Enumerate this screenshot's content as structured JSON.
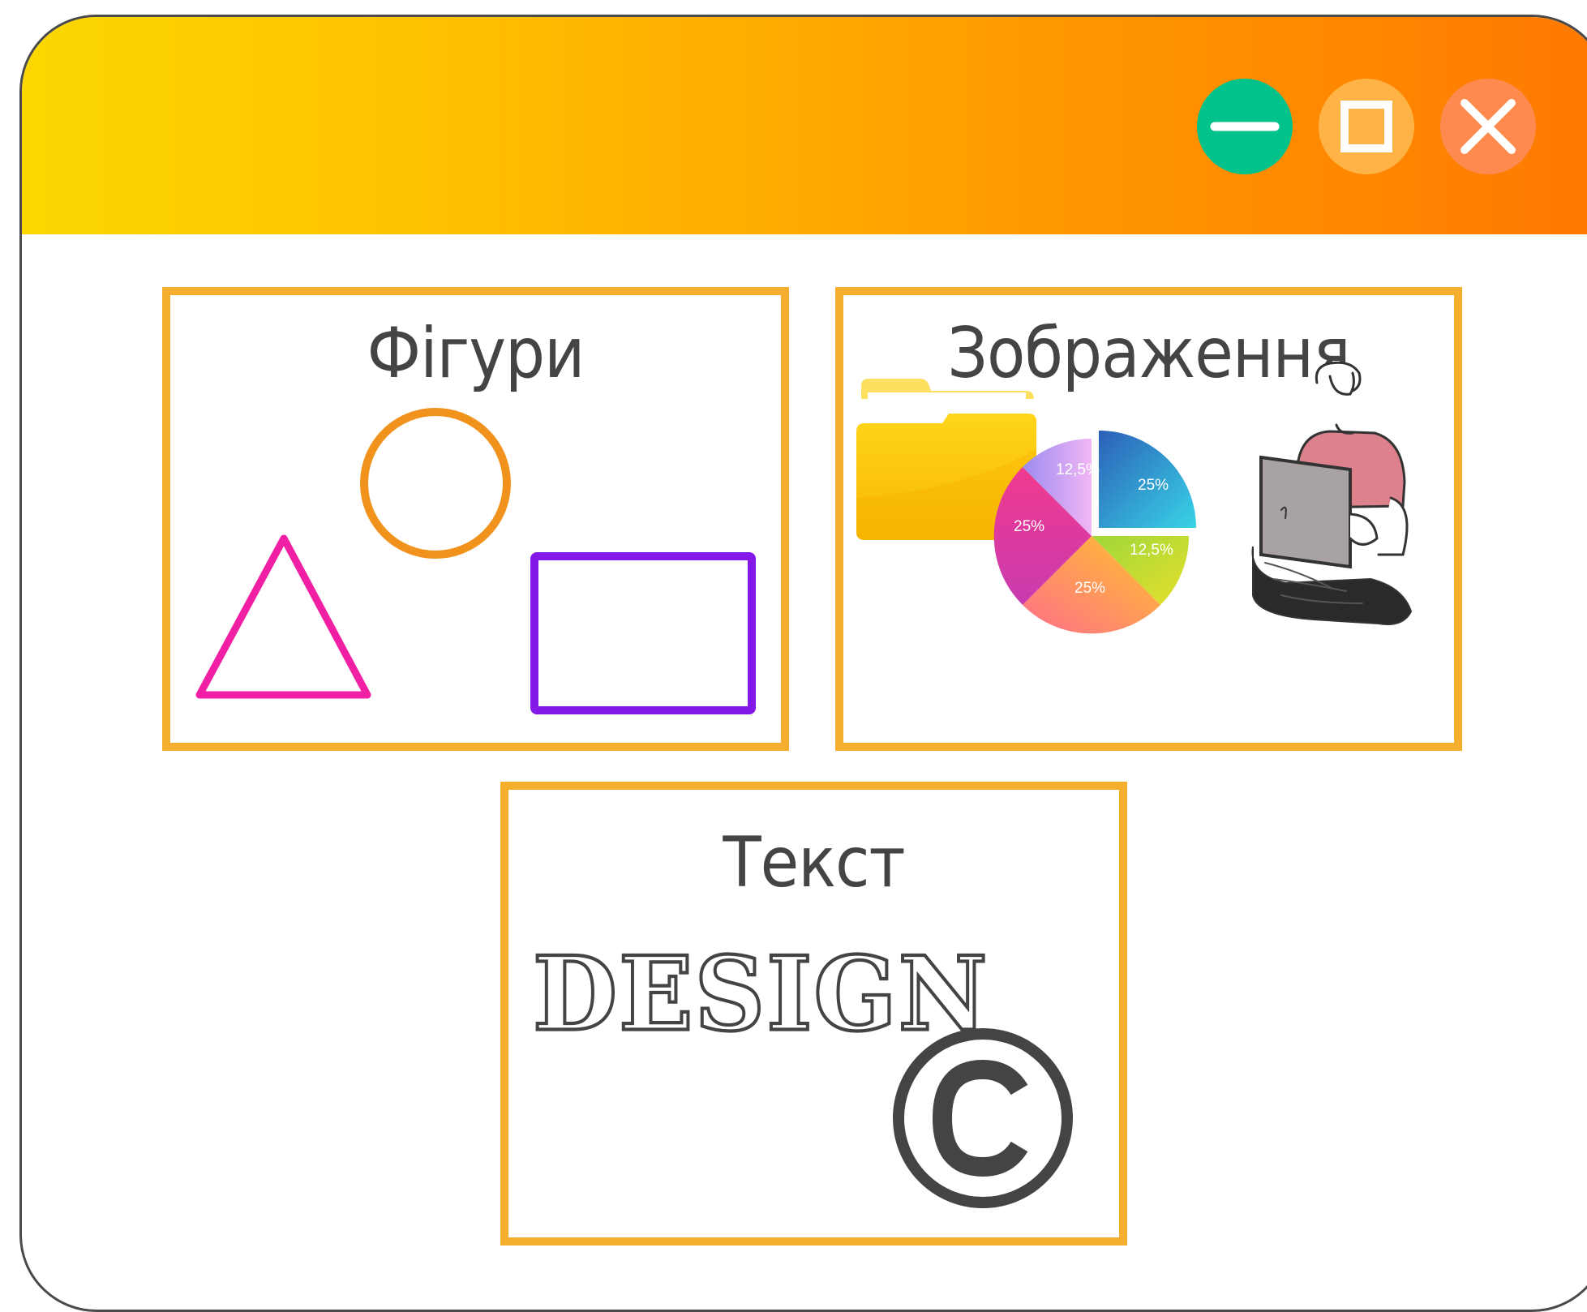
{
  "window": {
    "controls": {
      "minimize": "minimize-icon",
      "maximize": "maximize-icon",
      "close": "close-icon"
    },
    "colors": {
      "titlebar_start": "#fcd800",
      "titlebar_end": "#ff7800",
      "panel_border": "#f5ae2d",
      "minimize": "#00c28a",
      "maximize": "#ffb347",
      "close": "#ff8a50"
    }
  },
  "panels": {
    "shapes": {
      "title": "Фігури",
      "items": [
        "circle-icon",
        "triangle-icon",
        "rectangle-icon"
      ],
      "colors": {
        "circle": "#f0921c",
        "triangle": "#f01fa4",
        "rectangle": "#8418e8"
      }
    },
    "images": {
      "title": "Зображення",
      "items": [
        "folder-icon",
        "pie-chart-icon",
        "person-laptop-illustration"
      ],
      "pie_labels": [
        "25%",
        "12,5%",
        "25%",
        "25%",
        "12,5%"
      ]
    },
    "text": {
      "title": "Текст",
      "design_word": "DESIGN",
      "items": [
        "copyright-icon"
      ]
    }
  }
}
